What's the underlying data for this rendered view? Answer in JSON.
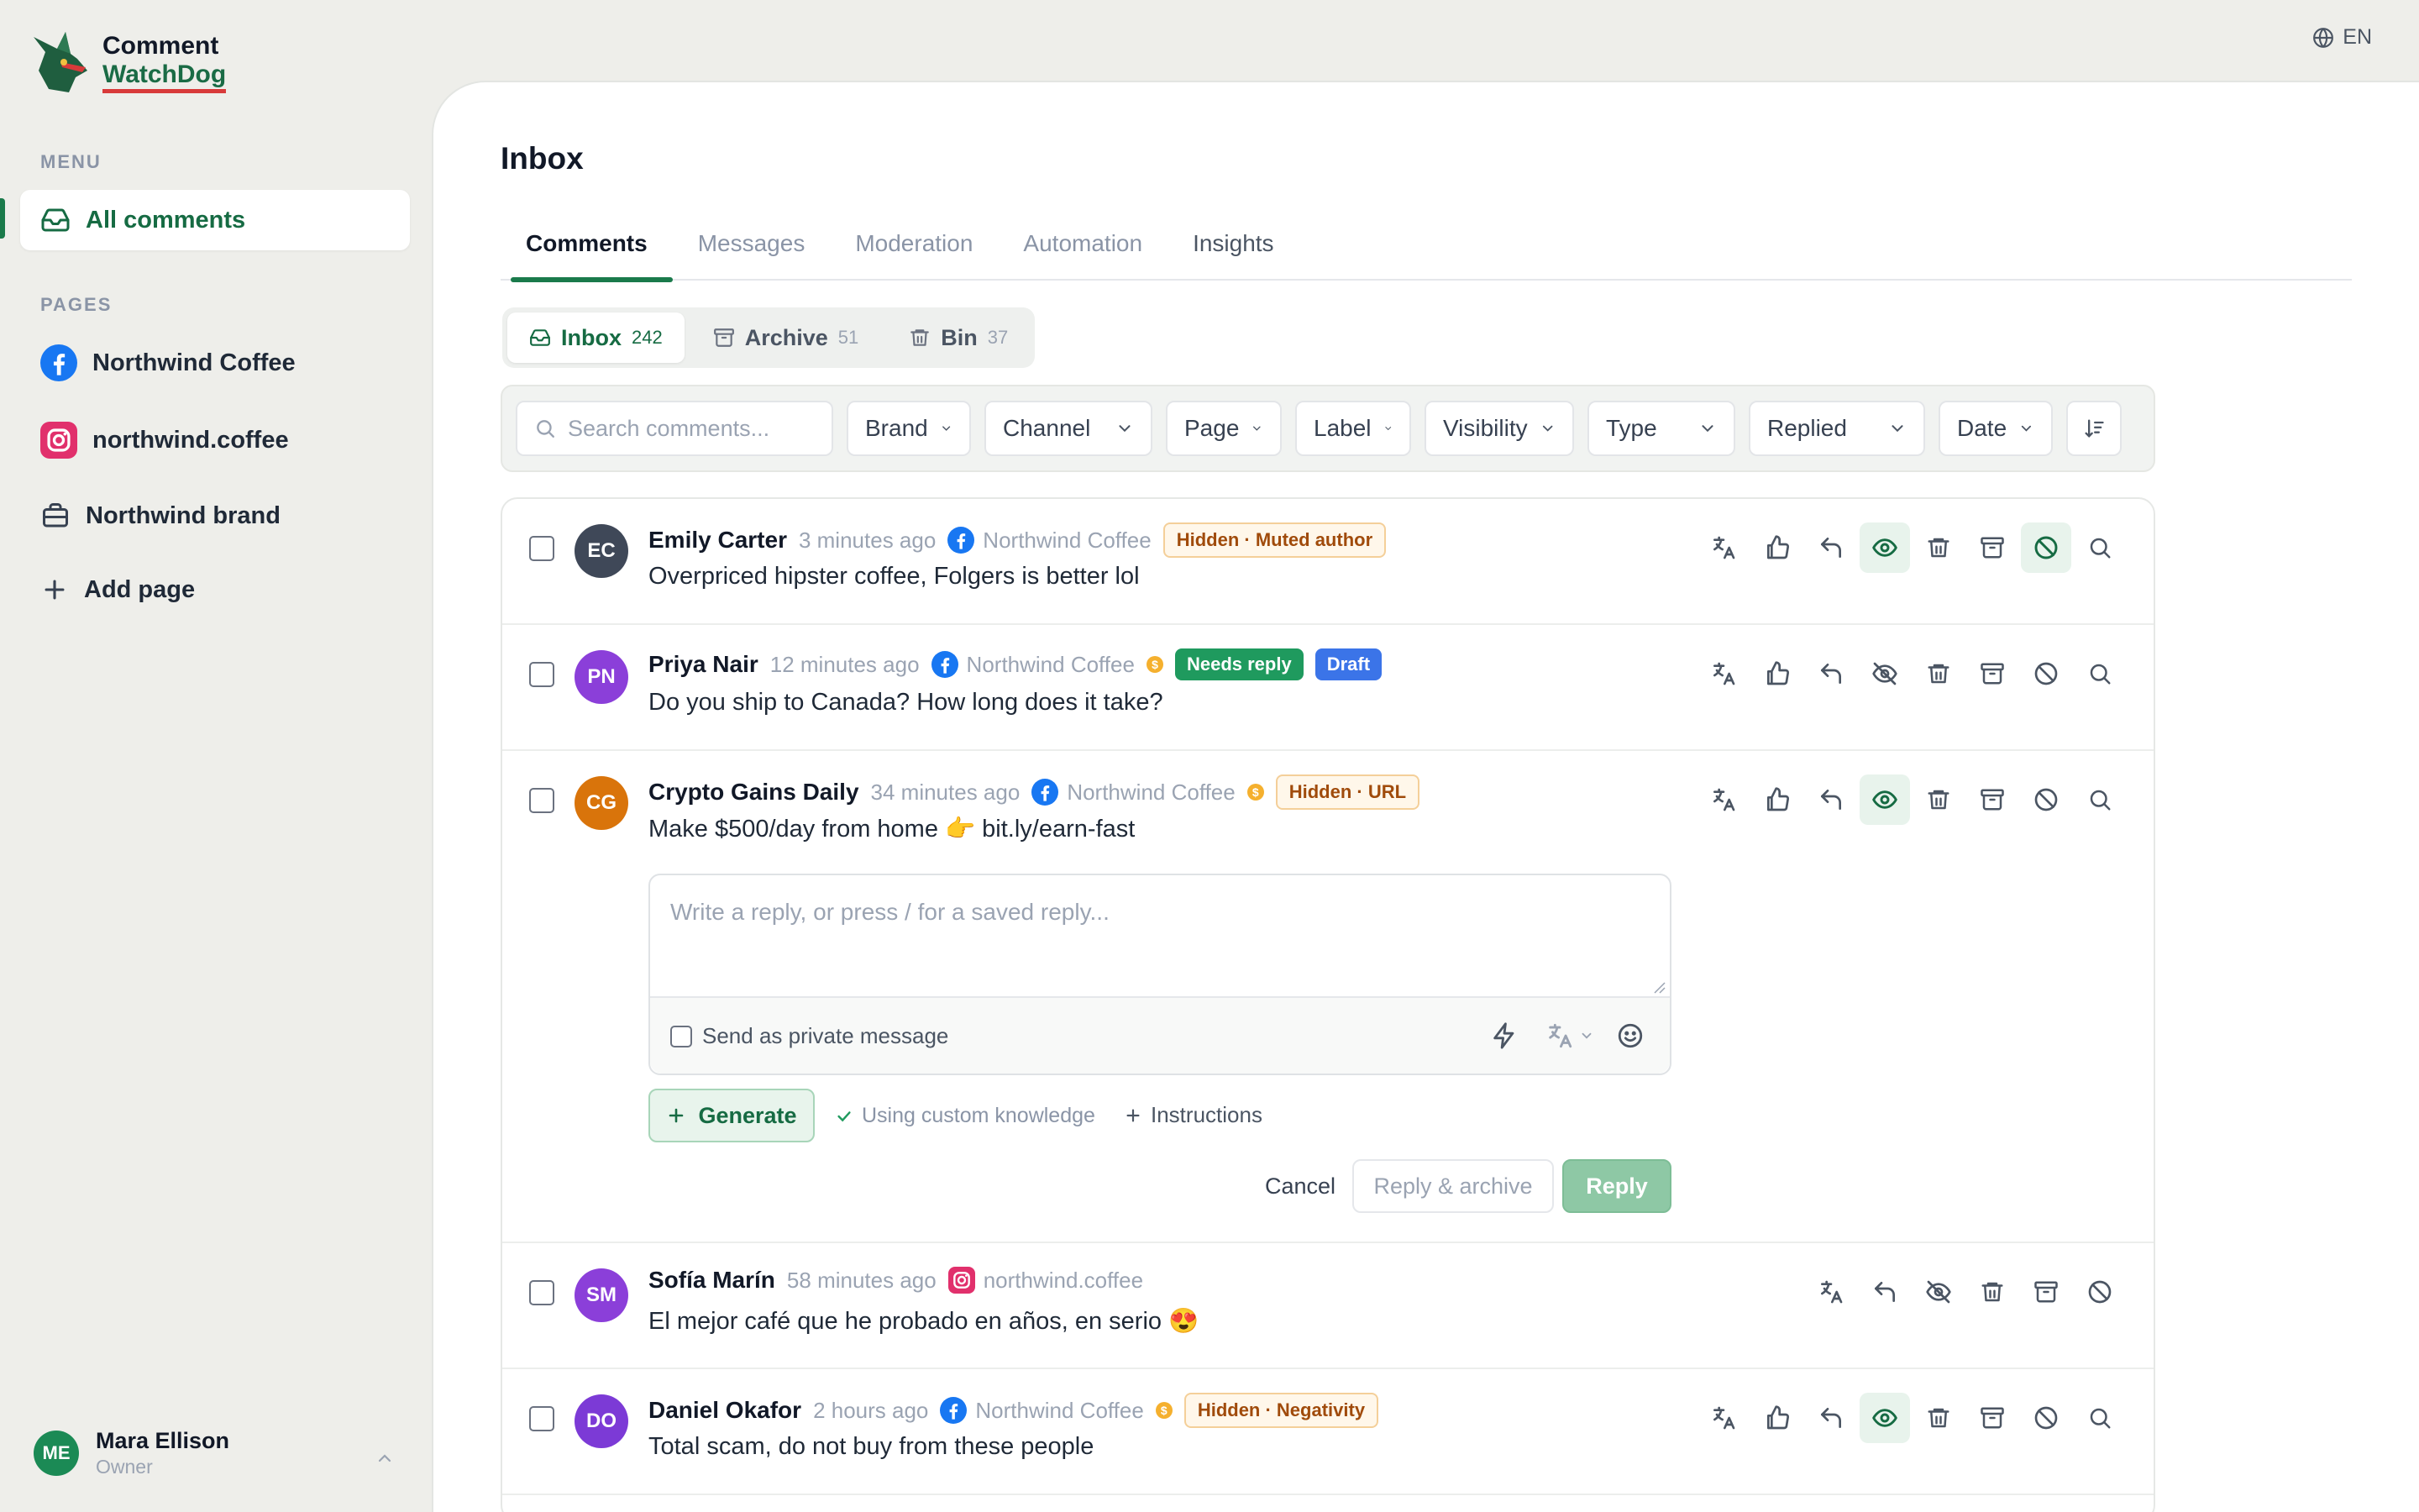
{
  "app": {
    "name_line1": "Comment",
    "name_line2": "WatchDog"
  },
  "lang": "EN",
  "sidebar": {
    "menu_label": "MENU",
    "menu_items": [
      {
        "label": "All comments",
        "icon": "inbox-icon"
      }
    ],
    "pages_label": "PAGES",
    "pages": [
      {
        "label": "Northwind Coffee",
        "icon": "facebook-icon"
      },
      {
        "label": "northwind.coffee",
        "icon": "instagram-icon"
      },
      {
        "label": "Northwind brand",
        "icon": "briefcase-icon"
      },
      {
        "label": "Add page",
        "icon": "plus-icon"
      }
    ],
    "user": {
      "initials": "ME",
      "name": "Mara Ellison",
      "role": "Owner"
    }
  },
  "main": {
    "title": "Inbox",
    "tabs": [
      "Comments",
      "Messages",
      "Moderation",
      "Automation",
      "Insights"
    ],
    "segments": [
      {
        "label": "Inbox",
        "count": "242"
      },
      {
        "label": "Archive",
        "count": "51"
      },
      {
        "label": "Bin",
        "count": "37"
      }
    ],
    "search_placeholder": "Search comments...",
    "filters": [
      "Brand",
      "Channel",
      "Page",
      "Label",
      "Visibility",
      "Type",
      "Replied",
      "Date"
    ]
  },
  "comments": [
    {
      "initials": "EC",
      "author": "Emily Carter",
      "time": "3 minutes ago",
      "page": "Northwind Coffee",
      "badges": [
        "Hidden · Muted author"
      ],
      "text": "Overpriced hipster coffee, Folgers is better lol"
    },
    {
      "initials": "PN",
      "author": "Priya Nair",
      "time": "12 minutes ago",
      "page": "Northwind Coffee",
      "badges": [
        "Needs reply",
        "Draft"
      ],
      "text": "Do you ship to Canada? How long does it take?"
    },
    {
      "initials": "CG",
      "author": "Crypto Gains Daily",
      "time": "34 minutes ago",
      "page": "Northwind Coffee",
      "badges": [
        "Hidden · URL"
      ],
      "text": "Make $500/day from home 👉  bit.ly/earn-fast"
    },
    {
      "initials": "SM",
      "author": "Sofía Marín",
      "time": "58 minutes ago",
      "page": "northwind.coffee",
      "badges": [],
      "text": "El mejor café que he probado en años, en serio 😍"
    },
    {
      "initials": "DO",
      "author": "Daniel Okafor",
      "time": "2 hours ago",
      "page": "Northwind Coffee",
      "badges": [
        "Hidden · Negativity"
      ],
      "text": "Total scam, do not buy from these people"
    }
  ],
  "reply": {
    "placeholder": "Write a reply, or press / for a saved reply...",
    "private_label": "Send as private message",
    "generate": "Generate",
    "knowledge": "Using custom knowledge",
    "instructions": "Instructions",
    "cancel": "Cancel",
    "reply_archive": "Reply & archive",
    "reply": "Reply"
  },
  "colors": {
    "brand": "#1a7a4b",
    "facebook": "#1877f2",
    "instagram": "#e1306c"
  }
}
